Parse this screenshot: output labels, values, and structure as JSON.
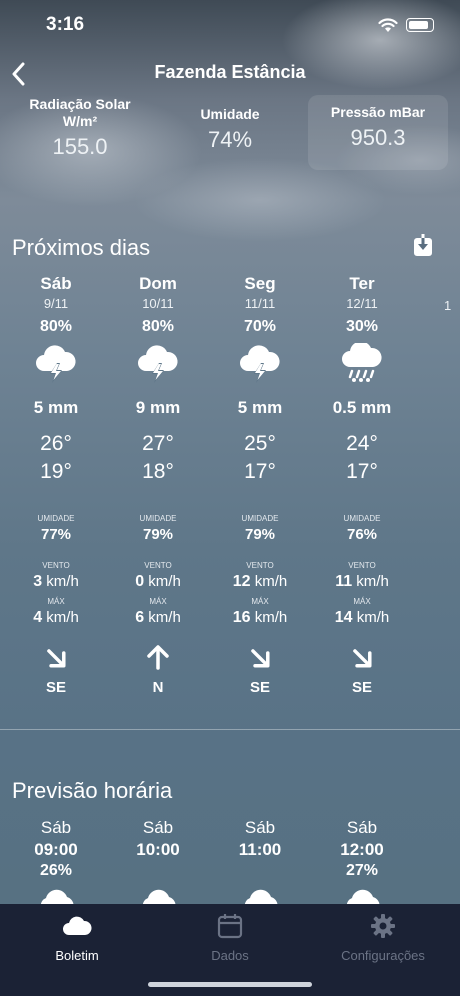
{
  "status": {
    "time": "3:16"
  },
  "header": {
    "title": "Fazenda Estância"
  },
  "metrics": [
    {
      "label": "Radiação Solar W/m²",
      "value": "155.0"
    },
    {
      "label": "Umidade",
      "value": "74%"
    },
    {
      "label": "Pressão mBar",
      "value": "950.3"
    }
  ],
  "forecast": {
    "title": "Próximos dias",
    "humidity_label": "UMIDADE",
    "wind_label": "VENTO",
    "max_label": "MÁX",
    "wind_unit": "km/h",
    "days": [
      {
        "day": "Sáb",
        "date": "9/11",
        "rain_chance": "80%",
        "icon": "thunderstorm-icon",
        "rain": "5 mm",
        "max": "26°",
        "min": "19°",
        "humidity": "77%",
        "wind": "3",
        "wind_max": "4",
        "dir": "SE"
      },
      {
        "day": "Dom",
        "date": "10/11",
        "rain_chance": "80%",
        "icon": "thunderstorm-icon",
        "rain": "9 mm",
        "max": "27°",
        "min": "18°",
        "humidity": "79%",
        "wind": "0",
        "wind_max": "6",
        "dir": "N"
      },
      {
        "day": "Seg",
        "date": "11/11",
        "rain_chance": "70%",
        "icon": "thunderstorm-icon",
        "rain": "5 mm",
        "max": "25°",
        "min": "17°",
        "humidity": "79%",
        "wind": "12",
        "wind_max": "16",
        "dir": "SE"
      },
      {
        "day": "Ter",
        "date": "12/11",
        "rain_chance": "30%",
        "icon": "hail-icon",
        "rain": "0.5 mm",
        "max": "24°",
        "min": "17°",
        "humidity": "76%",
        "wind": "11",
        "wind_max": "14",
        "dir": "SE"
      }
    ]
  },
  "hourly": {
    "title": "Previsão horária",
    "hours": [
      {
        "day": "Sáb",
        "time": "09:00",
        "pct": "26%"
      },
      {
        "day": "Sáb",
        "time": "10:00",
        "pct": ""
      },
      {
        "day": "Sáb",
        "time": "11:00",
        "pct": ""
      },
      {
        "day": "Sáb",
        "time": "12:00",
        "pct": "27%"
      }
    ]
  },
  "tabs": [
    {
      "label": "Boletim",
      "icon": "cloud-icon",
      "active": true
    },
    {
      "label": "Dados",
      "icon": "calendar-icon",
      "active": false
    },
    {
      "label": "Configurações",
      "icon": "gear-icon",
      "active": false
    }
  ]
}
